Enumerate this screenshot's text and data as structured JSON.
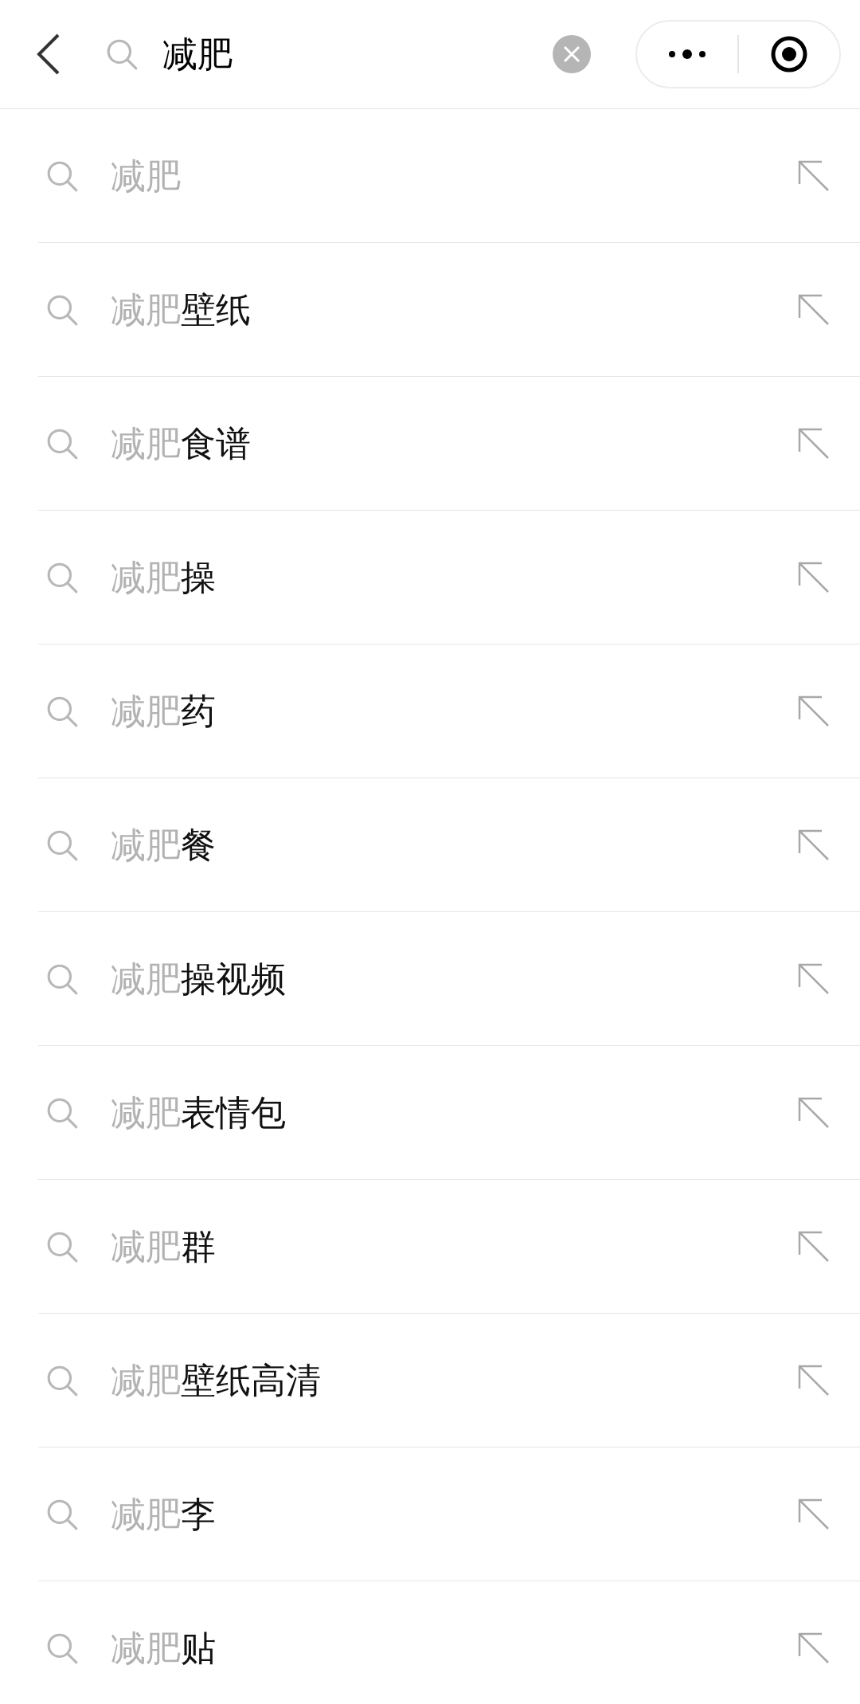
{
  "search": {
    "value": "减肥"
  },
  "suggestions": [
    {
      "match": "减肥"
    },
    {
      "match": "减肥",
      "rest": "壁纸"
    },
    {
      "match": "减肥",
      "rest": "食谱"
    },
    {
      "match": "减肥",
      "rest": "操"
    },
    {
      "match": "减肥",
      "rest": "药"
    },
    {
      "match": "减肥",
      "rest": "餐"
    },
    {
      "match": "减肥",
      "rest": "操视频"
    },
    {
      "match": "减肥",
      "rest": "表情包"
    },
    {
      "match": "减肥",
      "rest": "群"
    },
    {
      "match": "减肥",
      "rest": "壁纸高清"
    },
    {
      "match": "减肥",
      "rest": "李"
    },
    {
      "match": "减肥",
      "rest": "贴"
    }
  ]
}
